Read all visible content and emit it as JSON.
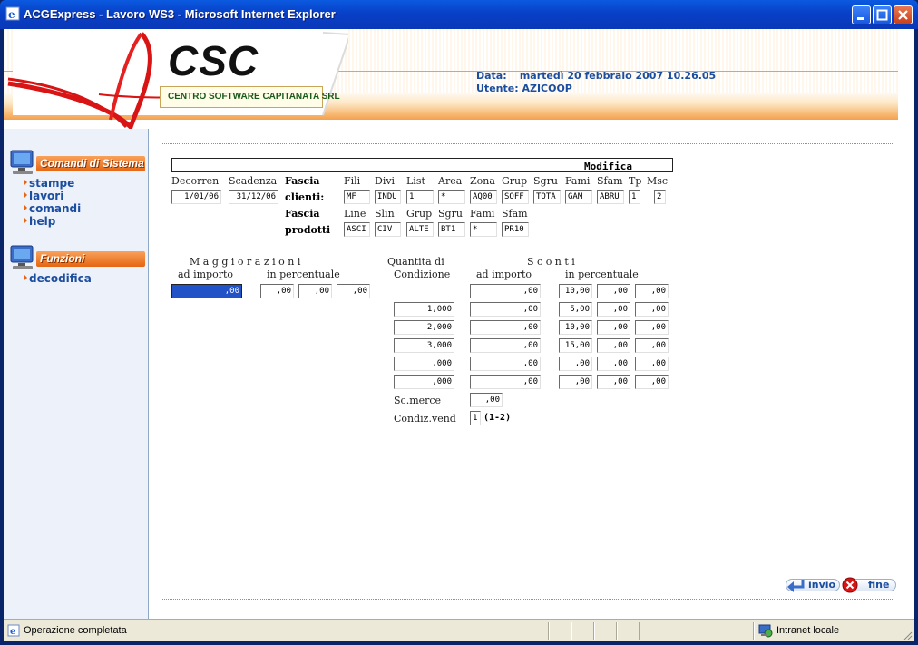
{
  "window": {
    "title": "ACGExpress - Lavoro WS3 - Microsoft Internet Explorer"
  },
  "header": {
    "logo": "CSC",
    "logo_sub": "CENTRO SOFTWARE CAPITANATA SRL",
    "data_label": "Data:",
    "data_value": "martedì 20 febbraio 2007 10.26.05",
    "user_label": "Utente:",
    "user_value": "AZICOOP"
  },
  "sidebar": {
    "system_title": "Comandi di Sistema",
    "system_items": [
      "stampe",
      "lavori",
      "comandi",
      "help"
    ],
    "functions_title": "Funzioni",
    "function_items": [
      "decodifica"
    ]
  },
  "form": {
    "mode": "Modifica",
    "labels": {
      "decorren": "Decorren",
      "scadenza": "Scadenza",
      "fascia": "Fascia",
      "clienti": "clienti:",
      "fascia2": "Fascia",
      "prodotti": "prodotti",
      "fili": "Fili",
      "divi": "Divi",
      "list": "List",
      "area": "Area",
      "zona": "Zona",
      "grup": "Grup",
      "sgru": "Sgru",
      "fami": "Fami",
      "sfam": "Sfam",
      "tp": "Tp",
      "msc": "Msc",
      "line": "Line",
      "slin": "Slin",
      "grup2": "Grup",
      "sgru2": "Sgru",
      "fami2": "Fami",
      "sfam2": "Sfam"
    },
    "clienti": {
      "decorren": "1/01/06",
      "scadenza": "31/12/06",
      "fili": "MF",
      "divi": "INDU",
      "list": "1",
      "area": "*",
      "zona": "AQ00",
      "grup": "SOFF",
      "sgru": "TOTA",
      "fami": "GAM",
      "sfam": "ABRU",
      "tp": "1",
      "msc": "2"
    },
    "prodotti": {
      "line": "ASCI",
      "slin": "CIV",
      "grup": "ALTE",
      "sgru": "BT1",
      "fami": "*",
      "sfam": "PR10"
    },
    "maggiorazioni": {
      "title": "M a g g i o r a z i o n i",
      "ad_importo_label": "ad importo",
      "in_percentuale_label": "in percentuale",
      "importo": ",00",
      "perc": [
        ",00",
        ",00",
        ",00"
      ]
    },
    "sconti": {
      "qty_label1": "Quantita di",
      "qty_label2": "Condizione",
      "title": "S c o n t i",
      "ad_importo_label": "ad importo",
      "in_percentuale_label": "in percentuale",
      "rows": [
        {
          "qty": "",
          "importo": ",00",
          "p1": "10,00",
          "p2": ",00",
          "p3": ",00"
        },
        {
          "qty": "1,000",
          "importo": ",00",
          "p1": "5,00",
          "p2": ",00",
          "p3": ",00"
        },
        {
          "qty": "2,000",
          "importo": ",00",
          "p1": "10,00",
          "p2": ",00",
          "p3": ",00"
        },
        {
          "qty": "3,000",
          "importo": ",00",
          "p1": "15,00",
          "p2": ",00",
          "p3": ",00"
        },
        {
          "qty": ",000",
          "importo": ",00",
          "p1": ",00",
          "p2": ",00",
          "p3": ",00"
        },
        {
          "qty": ",000",
          "importo": ",00",
          "p1": ",00",
          "p2": ",00",
          "p3": ",00"
        }
      ],
      "sc_merce_label": "Sc.merce",
      "sc_merce": ",00",
      "condiz_label": "Condiz.vend",
      "condiz": "1",
      "condiz_hint": "(1-2)"
    }
  },
  "buttons": {
    "invio": "invio",
    "fine": "fine"
  },
  "status": {
    "text": "Operazione completata",
    "zone": "Intranet locale"
  }
}
